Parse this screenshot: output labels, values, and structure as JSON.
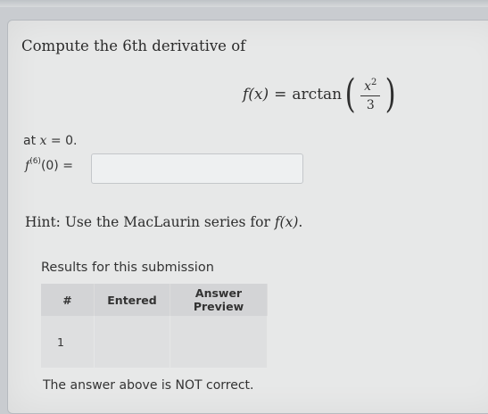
{
  "problem": {
    "intro": "Compute the 6th derivative of",
    "func_lhs": "f(x)",
    "equals": "=",
    "func_name": "arctan",
    "frac_num": "x",
    "frac_exp": "2",
    "frac_den": "3",
    "at_text": "at ",
    "at_var": "x",
    "at_value": " = 0.",
    "answer_func": "f",
    "answer_order": "(6)",
    "answer_arg": "(0) =",
    "answer_value": ""
  },
  "hint": {
    "prefix": "Hint: Use the MacLaurin series for ",
    "func": "f(x)",
    "suffix": "."
  },
  "results": {
    "title": "Results for this submission",
    "headers": [
      "#",
      "Entered",
      "Answer Preview"
    ],
    "rows": [
      {
        "num": "1",
        "entered": "",
        "preview": ""
      }
    ],
    "status": "The answer above is NOT correct."
  }
}
